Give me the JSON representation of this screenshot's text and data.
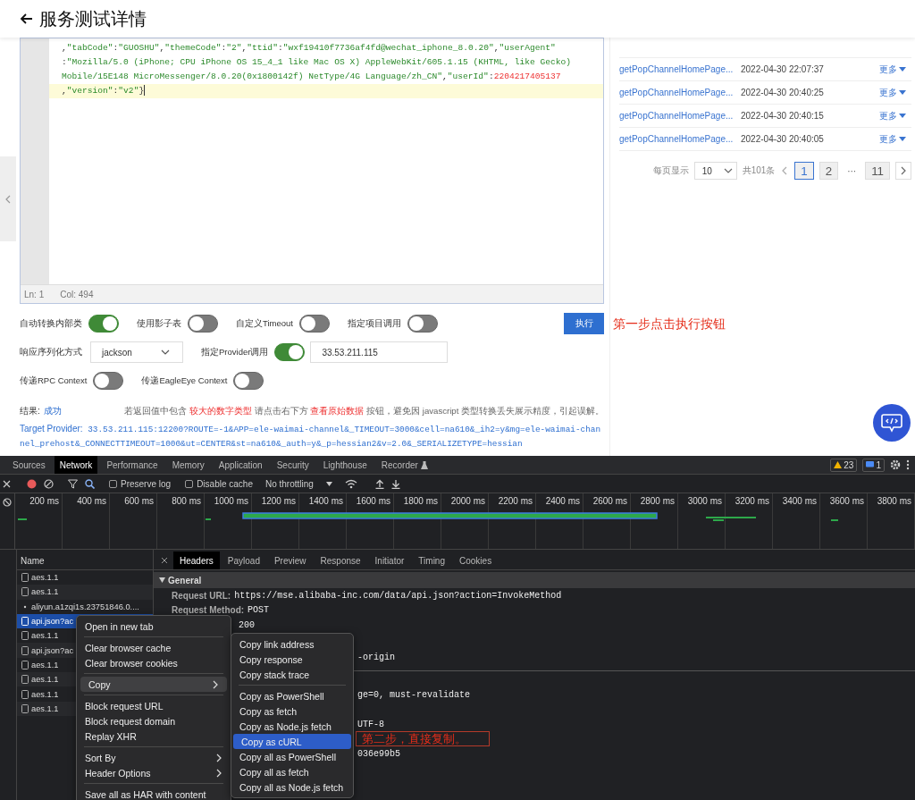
{
  "page": {
    "title": "服务测试详情"
  },
  "editor": {
    "lines": [
      {
        "current": false,
        "tokens": [
          {
            "text": ",",
            "kind": "punct"
          },
          {
            "text": "\"tabCode\"",
            "kind": "string"
          },
          {
            "text": ":",
            "kind": "punct"
          },
          {
            "text": "\"GUOSHU\"",
            "kind": "string"
          },
          {
            "text": ",",
            "kind": "punct"
          },
          {
            "text": "\"themeCode\"",
            "kind": "string"
          },
          {
            "text": ":",
            "kind": "punct"
          },
          {
            "text": "\"2\"",
            "kind": "string"
          },
          {
            "text": ",",
            "kind": "punct"
          },
          {
            "text": "\"ttid\"",
            "kind": "string"
          },
          {
            "text": ":",
            "kind": "punct"
          },
          {
            "text": "\"wxf19410f7736af4fd@wechat_iphone_8.0.20\"",
            "kind": "string"
          },
          {
            "text": ",",
            "kind": "punct"
          },
          {
            "text": "\"userAgent\"",
            "kind": "string"
          }
        ]
      },
      {
        "current": false,
        "tokens": [
          {
            "text": ":",
            "kind": "punct"
          },
          {
            "text": "\"Mozilla/5.0 (iPhone; CPU iPhone OS 15_4_1 like Mac OS X) AppleWebKit/605.1.15 (KHTML, like Gecko)",
            "kind": "string"
          }
        ]
      },
      {
        "current": false,
        "tokens": [
          {
            "text": "Mobile/15E148 MicroMessenger/8.0.20(0x1800142f) NetType/4G Language/zh_CN\"",
            "kind": "string"
          },
          {
            "text": ",",
            "kind": "punct"
          },
          {
            "text": "\"userId\"",
            "kind": "string"
          },
          {
            "text": ":",
            "kind": "punct"
          },
          {
            "text": "2204217405137",
            "kind": "number"
          }
        ]
      },
      {
        "current": true,
        "tokens": [
          {
            "text": ",",
            "kind": "punct"
          },
          {
            "text": "\"version\"",
            "kind": "string"
          },
          {
            "text": ":",
            "kind": "punct"
          },
          {
            "text": "\"v2\"",
            "kind": "string"
          },
          {
            "text": "}",
            "kind": "punct"
          }
        ]
      }
    ],
    "status": {
      "line": "Ln: 1",
      "column": "Col: 494"
    }
  },
  "history": {
    "rows": [
      {
        "name": "getPopChannelHomePage...",
        "time": "2022-04-30 22:07:37",
        "action": "更多"
      },
      {
        "name": "getPopChannelHomePage...",
        "time": "2022-04-30 20:40:25",
        "action": "更多"
      },
      {
        "name": "getPopChannelHomePage...",
        "time": "2022-04-30 20:40:15",
        "action": "更多"
      },
      {
        "name": "getPopChannelHomePage...",
        "time": "2022-04-30 20:40:05",
        "action": "更多"
      }
    ],
    "pagination": {
      "size_label": "每页显示",
      "size": "10",
      "total": "共101条",
      "pages": [
        {
          "label": "1",
          "kind": "page",
          "selected": true
        },
        {
          "label": "2",
          "kind": "page",
          "selected": false
        },
        {
          "label": "···",
          "kind": "ellipsis"
        },
        {
          "label": "11",
          "kind": "page",
          "selected": false
        }
      ]
    }
  },
  "form": {
    "rows": [
      {
        "items": [
          {
            "kind": "toggle",
            "label": "自动转换内部类",
            "on": true
          },
          {
            "kind": "toggle",
            "label": "使用影子表",
            "on": false
          },
          {
            "kind": "toggle",
            "label": "自定义Timeout",
            "on": false
          },
          {
            "kind": "toggle",
            "label": "指定项目调用",
            "on": false
          },
          {
            "kind": "button",
            "label": "执行"
          }
        ]
      },
      {
        "items": [
          {
            "kind": "select",
            "label": "响应序列化方式",
            "value": "jackson"
          },
          {
            "kind": "toggle",
            "label": "指定Provider调用",
            "on": true
          },
          {
            "kind": "input",
            "value": "33.53.211.115"
          }
        ]
      },
      {
        "items": [
          {
            "kind": "toggle",
            "label": "传递RPC Context",
            "on": false
          },
          {
            "kind": "toggle",
            "label": "传递EagleEye Context",
            "on": false
          }
        ]
      }
    ]
  },
  "result": {
    "label": "结果:",
    "value": "成功",
    "notice": [
      {
        "text": "若返回值中包含 ",
        "highlight": false
      },
      {
        "text": "较大的数字类型",
        "highlight": true
      },
      {
        "text": " 请点击右下方 ",
        "highlight": false
      },
      {
        "text": "查看原始数据",
        "highlight": true
      },
      {
        "text": " 按钮，避免因 javascript 类型转换丢失展示精度，引起误解。",
        "highlight": false
      }
    ]
  },
  "target_provider": {
    "label": "Target Provider:",
    "value": "33.53.211.115:12200?ROUTE=-1&APP=ele-waimai-channel&_TIMEOUT=3000&cell=na610&_ih2=y&mg=ele-waimai-channel_prehost&_CONNECTTIMEOUT=1000&ut=CENTER&st=na610&_auth=y&_p=hessian2&v=2.0&_SERIALIZETYPE=hessian"
  },
  "annotations": [
    "第一步点击执行按钮",
    "第二步，直接复制。"
  ],
  "devtools": {
    "tabs": [
      {
        "label": "Sources",
        "selected": false
      },
      {
        "label": "Network",
        "selected": true
      },
      {
        "label": "Performance",
        "selected": false
      },
      {
        "label": "Memory",
        "selected": false
      },
      {
        "label": "Application",
        "selected": false
      },
      {
        "label": "Security",
        "selected": false
      },
      {
        "label": "Lighthouse",
        "selected": false
      },
      {
        "label": "Recorder",
        "selected": false
      }
    ],
    "warnings": "23",
    "messages": "1",
    "toolbar": {
      "preserve_log": {
        "label": "Preserve log",
        "checked": false
      },
      "disable_cache": {
        "label": "Disable cache",
        "checked": false
      },
      "throttling": "No throttling"
    },
    "timeline_ticks": [
      "200 ms",
      "400 ms",
      "600 ms",
      "800 ms",
      "1000 ms",
      "1200 ms",
      "1400 ms",
      "1600 ms",
      "1800 ms",
      "2000 ms",
      "2200 ms",
      "2400 ms",
      "2600 ms",
      "2800 ms",
      "3000 ms",
      "3200 ms",
      "3400 ms",
      "3600 ms",
      "3800 ms"
    ],
    "requests": {
      "header": "Name",
      "items": [
        {
          "name": "aes.1.1",
          "kind": "file",
          "selected": false
        },
        {
          "name": "aes.1.1",
          "kind": "file",
          "selected": false
        },
        {
          "name": "aliyun.a1zqi1s.23751846.0....",
          "kind": "dot",
          "selected": false
        },
        {
          "name": "api.json?ac",
          "kind": "file",
          "selected": true
        },
        {
          "name": "aes.1.1",
          "kind": "file",
          "selected": false
        },
        {
          "name": "api.json?ac",
          "kind": "file",
          "selected": false
        },
        {
          "name": "aes.1.1",
          "kind": "file",
          "selected": false
        },
        {
          "name": "aes.1.1",
          "kind": "file",
          "selected": false
        },
        {
          "name": "aes.1.1",
          "kind": "file",
          "selected": false
        },
        {
          "name": "aes.1.1",
          "kind": "file",
          "selected": false
        }
      ]
    },
    "detail_tabs": [
      {
        "label": "Headers",
        "selected": true
      },
      {
        "label": "Payload",
        "selected": false
      },
      {
        "label": "Preview",
        "selected": false
      },
      {
        "label": "Response",
        "selected": false
      },
      {
        "label": "Initiator",
        "selected": false
      },
      {
        "label": "Timing",
        "selected": false
      },
      {
        "label": "Cookies",
        "selected": false
      }
    ],
    "general": {
      "title": "General",
      "expanded": true,
      "rows": [
        {
          "label": "Request URL:",
          "value": "https://mse.alibaba-inc.com/data/api.json?action=InvokeMethod"
        },
        {
          "label": "Request Method:",
          "value": "POST"
        },
        {
          "value": "200"
        },
        {
          "value": "-origin"
        },
        {
          "value": "ge=0, must-revalidate"
        },
        {
          "value": "UTF-8"
        },
        {
          "value": "036e99b5"
        }
      ]
    },
    "context_menu": {
      "groups": [
        [
          {
            "label": "Open in new tab",
            "selected": false,
            "submenu": false
          }
        ],
        [
          {
            "label": "Clear browser cache",
            "selected": false,
            "submenu": false
          },
          {
            "label": "Clear browser cookies",
            "selected": false,
            "submenu": false
          }
        ],
        [
          {
            "label": "Copy",
            "selected": true,
            "submenu": true
          }
        ],
        [
          {
            "label": "Block request URL",
            "selected": false,
            "submenu": false
          },
          {
            "label": "Block request domain",
            "selected": false,
            "submenu": false
          },
          {
            "label": "Replay XHR",
            "selected": false,
            "submenu": false
          }
        ],
        [
          {
            "label": "Sort By",
            "selected": false,
            "submenu": true
          },
          {
            "label": "Header Options",
            "selected": false,
            "submenu": true
          }
        ],
        [
          {
            "label": "Save all as HAR with content",
            "selected": false,
            "submenu": false
          }
        ]
      ]
    },
    "copy_submenu": {
      "groups": [
        [
          {
            "label": "Copy link address",
            "selected": false
          },
          {
            "label": "Copy response",
            "selected": false
          },
          {
            "label": "Copy stack trace",
            "selected": false
          }
        ],
        [
          {
            "label": "Copy as PowerShell",
            "selected": false
          },
          {
            "label": "Copy as fetch",
            "selected": false
          },
          {
            "label": "Copy as Node.js fetch",
            "selected": false
          },
          {
            "label": "Copy as cURL",
            "selected": true
          },
          {
            "label": "Copy all as PowerShell",
            "selected": false
          },
          {
            "label": "Copy all as fetch",
            "selected": false
          },
          {
            "label": "Copy all as Node.js fetch",
            "selected": false
          }
        ]
      ]
    }
  }
}
